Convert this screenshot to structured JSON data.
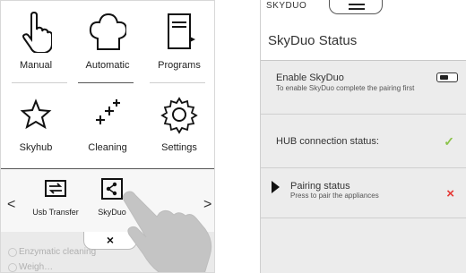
{
  "left_screen": {
    "tiles": [
      {
        "label": "Manual",
        "icon": "hand-pointer-icon"
      },
      {
        "label": "Automatic",
        "icon": "chef-hat-icon"
      },
      {
        "label": "Programs",
        "icon": "book-icon"
      },
      {
        "label": "Skyhub",
        "icon": "star-icon"
      },
      {
        "label": "Cleaning",
        "icon": "sparkle-icon"
      },
      {
        "label": "Settings",
        "icon": "gear-icon"
      }
    ],
    "submenu": {
      "usb_label": "Usb Transfer",
      "skyduo_label": "SkyDuo",
      "left_arrow": "<",
      "right_arrow": ">"
    },
    "close_label": "×",
    "faded_item_1": "Enzymatic cleaning",
    "faded_item_2": "Weigh…"
  },
  "right_screen": {
    "brand": "SKYDUO",
    "title": "SkyDuo Status",
    "enable": {
      "label": "Enable SkyDuo",
      "hint": "To enable SkyDuo complete the pairing first",
      "state": "off"
    },
    "hub": {
      "label": "HUB connection status:",
      "status": "connected",
      "check_glyph": "✓"
    },
    "pairing": {
      "label": "Pairing status",
      "hint": "Press to pair the appliances",
      "status": "not-paired",
      "cross_glyph": "×"
    }
  },
  "colors": {
    "check_green": "#8bc34a",
    "cross_red": "#e53935",
    "panel_bg": "#ececec"
  }
}
